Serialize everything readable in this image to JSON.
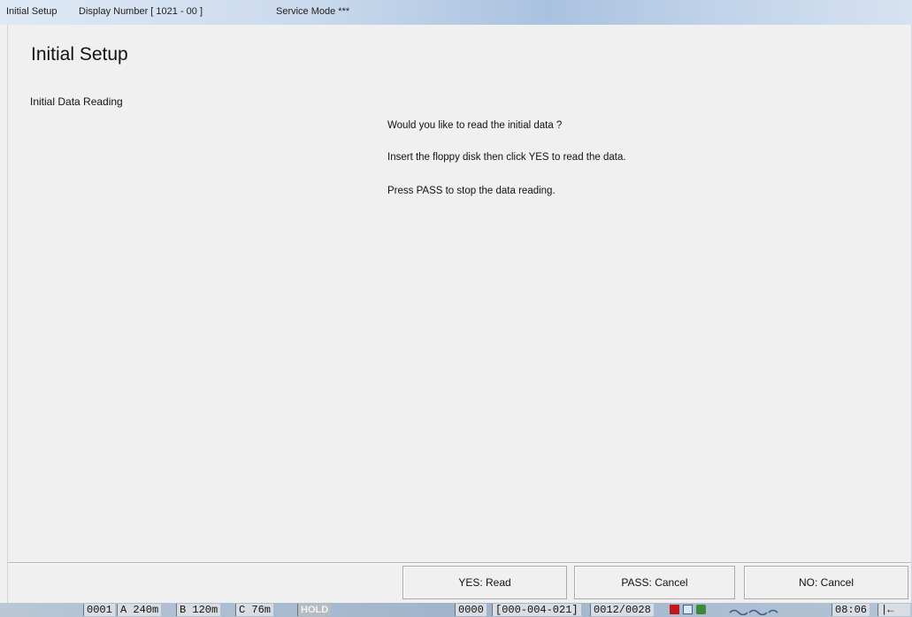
{
  "titlebar": {
    "app_title": "Initial Setup",
    "display_number": "Display Number [ 1021 - 00 ]",
    "service_mode": "Service Mode ***"
  },
  "page": {
    "title": "Initial Setup",
    "section_label": "Initial Data Reading",
    "messages": [
      "Would you like to read the initial data ?",
      "Insert the floppy disk then click YES to read the data.",
      "Press PASS to stop the data reading."
    ]
  },
  "buttons": {
    "yes": "YES: Read",
    "pass": "PASS: Cancel",
    "no": "NO: Cancel"
  },
  "statusbar": {
    "counter": "0001",
    "a_label": "A 240m",
    "b_label": "B 120m",
    "c_label": "C  76m",
    "hold": "HOLD",
    "code": "0000",
    "range": "[000-004-021]",
    "progress": "0012/0028",
    "time": "08:06",
    "tail": "|←"
  },
  "colors": {
    "status_icon_1": "#c0181a",
    "status_icon_2": "#2e7d2e",
    "status_icon_3": "#3a8a3a"
  }
}
